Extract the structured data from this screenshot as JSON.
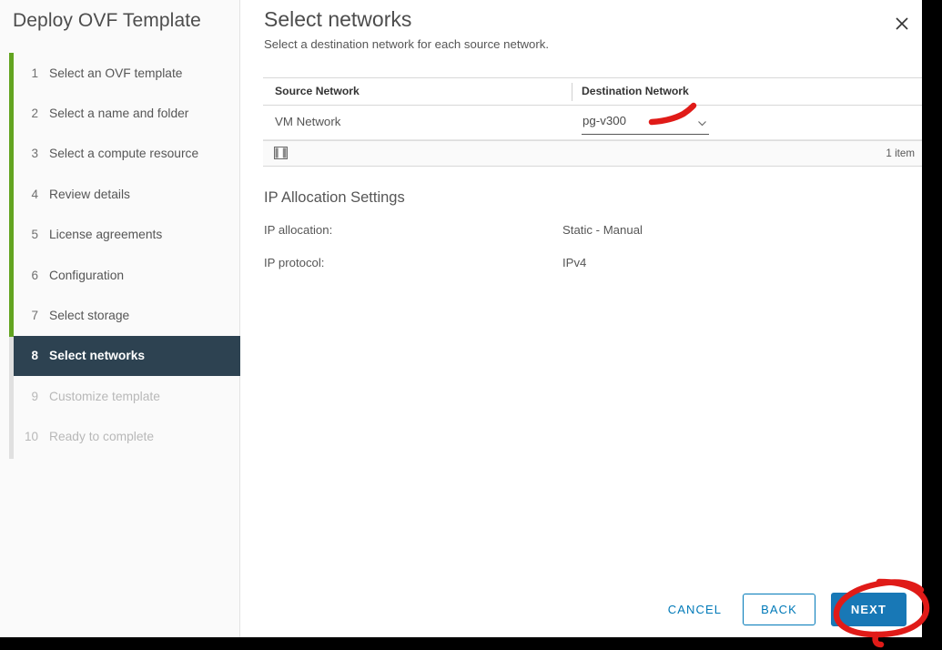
{
  "window": {
    "title": "Deploy OVF Template",
    "close_icon": "close-icon"
  },
  "sidebar": {
    "steps": [
      {
        "num": "1",
        "label": "Select an OVF template",
        "state": "done"
      },
      {
        "num": "2",
        "label": "Select a name and folder",
        "state": "done"
      },
      {
        "num": "3",
        "label": "Select a compute resource",
        "state": "done"
      },
      {
        "num": "4",
        "label": "Review details",
        "state": "done"
      },
      {
        "num": "5",
        "label": "License agreements",
        "state": "done"
      },
      {
        "num": "6",
        "label": "Configuration",
        "state": "done"
      },
      {
        "num": "7",
        "label": "Select storage",
        "state": "done"
      },
      {
        "num": "8",
        "label": "Select networks",
        "state": "active"
      },
      {
        "num": "9",
        "label": "Customize template",
        "state": "upcoming"
      },
      {
        "num": "10",
        "label": "Ready to complete",
        "state": "upcoming"
      }
    ]
  },
  "main": {
    "title": "Select networks",
    "subtitle": "Select a destination network for each source network."
  },
  "networks_table": {
    "columns": [
      "Source Network",
      "Destination Network"
    ],
    "rows": [
      {
        "source": "VM Network",
        "destination": "pg-v300"
      }
    ],
    "item_count": "1 item",
    "columns_toggle_icon": "columns-toggle-icon",
    "dropdown_icon": "chevron-down-icon"
  },
  "ip_settings": {
    "heading": "IP Allocation Settings",
    "rows": [
      {
        "label": "IP allocation:",
        "value": "Static - Manual"
      },
      {
        "label": "IP protocol:",
        "value": "IPv4"
      }
    ]
  },
  "footer": {
    "cancel_label": "CANCEL",
    "back_label": "BACK",
    "next_label": "NEXT"
  },
  "colors": {
    "accent_blue": "#1878b6",
    "link_blue": "#0079b8",
    "progress_green": "#62a420",
    "active_step_bg": "#2d4251",
    "annotation_red": "#e01b18"
  }
}
